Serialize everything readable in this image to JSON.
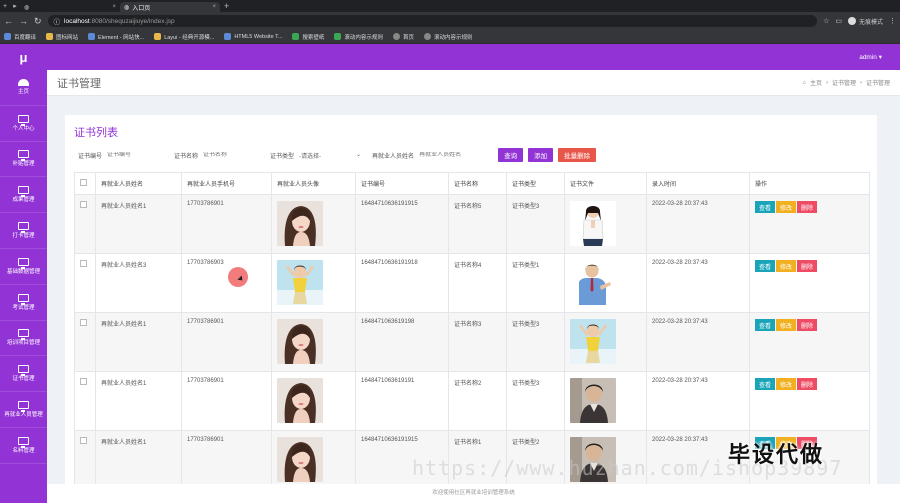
{
  "browser": {
    "tabs": [
      {
        "label": "入口页",
        "active": true
      }
    ],
    "url_host": "localhost",
    "url_path": ":8080/shequzaijiuye/index.jsp",
    "incognito_label": "无痕模式",
    "bookmarks": [
      "百度翻译",
      "图标网站",
      "Element - 网站快...",
      "Layui - 经典开源模...",
      "HTML5 Website T...",
      "搜索壁纸",
      "滚动内容示规则",
      "首页",
      "滚动内容示规则"
    ]
  },
  "topbar": {
    "logo": "μ",
    "user": "admin"
  },
  "sidebar": {
    "items": [
      {
        "label": "主页",
        "icon": "dashboard-icon"
      },
      {
        "label": "个人中心",
        "icon": "monitor-icon"
      },
      {
        "label": "补贴管理",
        "icon": "monitor-icon"
      },
      {
        "label": "成果管理",
        "icon": "monitor-icon"
      },
      {
        "label": "打卡管理",
        "icon": "monitor-icon"
      },
      {
        "label": "基础数据管理",
        "icon": "monitor-icon"
      },
      {
        "label": "考试管理",
        "icon": "monitor-icon"
      },
      {
        "label": "培训项目管理",
        "icon": "monitor-icon"
      },
      {
        "label": "证书管理",
        "icon": "monitor-icon"
      },
      {
        "label": "再就业人员管理",
        "icon": "monitor-icon"
      },
      {
        "label": "名料管理",
        "icon": "monitor-icon"
      }
    ]
  },
  "page": {
    "title": "证书管理",
    "breadcrumb": [
      "主页",
      "证书管理",
      "证书管理"
    ],
    "card_title": "证书列表"
  },
  "filters": {
    "cert_no_label": "证书编号",
    "cert_no_placeholder": "证书编号",
    "cert_name_label": "证书名称",
    "cert_name_placeholder": "证书名称",
    "cert_type_label": "证书类型",
    "cert_type_value": "-请选择-",
    "person_label": "再就业人员姓名",
    "person_placeholder": "再就业人员姓名",
    "search_btn": "查询",
    "add_btn": "添加",
    "batch_delete_btn": "批量删除"
  },
  "table": {
    "headers": [
      "再就业人员姓名",
      "再就业人员手机号",
      "再就业人员头像",
      "证书编号",
      "证书名称",
      "证书类型",
      "证书文件",
      "录入时间",
      "操作"
    ],
    "actions": {
      "view": "查看",
      "edit": "修改",
      "delete": "删除"
    },
    "rows": [
      {
        "name": "再就业人员姓名1",
        "phone": "17703786901",
        "avatar": "woman-avatar",
        "cert_no": "16484710636191915",
        "cert_name": "证书名称5",
        "cert_type": "证书类型3",
        "file": "woman-white-shirt",
        "time": "2022-03-28 20:37:43"
      },
      {
        "name": "再就业人员姓名3",
        "phone": "17703786903",
        "avatar": "woman-yellow",
        "cert_no": "16484710636191918",
        "cert_name": "证书名称4",
        "cert_type": "证书类型1",
        "file": "man-blue-shirt",
        "time": "2022-03-28 20:37:43"
      },
      {
        "name": "再就业人员姓名1",
        "phone": "17703786901",
        "avatar": "woman-avatar",
        "cert_no": "1648471063619198",
        "cert_name": "证书名称3",
        "cert_type": "证书类型3",
        "file": "woman-yellow",
        "time": "2022-03-28 20:37:43"
      },
      {
        "name": "再就业人员姓名1",
        "phone": "17703786901",
        "avatar": "woman-avatar",
        "cert_no": "1648471063619191",
        "cert_name": "证书名称2",
        "cert_type": "证书类型3",
        "file": "man-portrait",
        "time": "2022-03-28 20:37:43"
      },
      {
        "name": "再就业人员姓名1",
        "phone": "17703786901",
        "avatar": "woman-avatar",
        "cert_no": "16484710636191915",
        "cert_name": "证书名称1",
        "cert_type": "证书类型2",
        "file": "man-portrait",
        "time": "2022-03-28 20:37:43"
      }
    ]
  },
  "footer": "欢迎使用社区再就业培训管理系统",
  "watermark": {
    "url": "https://www.huzhan.com/ishop39897",
    "text": "毕设代做"
  }
}
